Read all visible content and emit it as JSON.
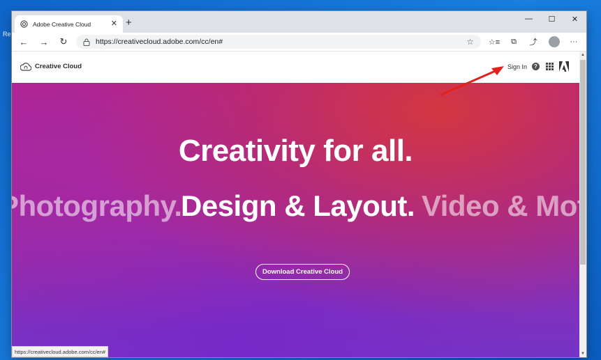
{
  "desktop": {
    "edge_label": "Re"
  },
  "browser": {
    "tab": {
      "title": "Adobe Creative Cloud",
      "close": "✕"
    },
    "new_tab": "+",
    "window_controls": {
      "minimize": "—",
      "maximize": "☐",
      "close": "✕"
    },
    "nav": {
      "back": "←",
      "forward": "→",
      "refresh": "↻"
    },
    "address": {
      "url": "https://creativecloud.adobe.com/cc/en#"
    },
    "toolbar_icons": {
      "favorite": "☆",
      "favorites": "☆≡",
      "collections": "⧉",
      "share": "⤴",
      "menu": "···"
    }
  },
  "site_header": {
    "brand": "Creative Cloud",
    "sign_in": "Sign In",
    "help": "?"
  },
  "hero": {
    "title": "Creativity for all.",
    "carousel": {
      "previous": "Photography.",
      "current": "Design & Layout.",
      "next": "Video & Motion."
    },
    "download_button": "Download Creative Cloud"
  },
  "status_bar": {
    "url": "https://creativecloud.adobe.com/cc/en#"
  },
  "colors": {
    "annotation_arrow": "#e3201b",
    "hero_top": "#b0238f",
    "hero_bottom": "#7534c6"
  }
}
